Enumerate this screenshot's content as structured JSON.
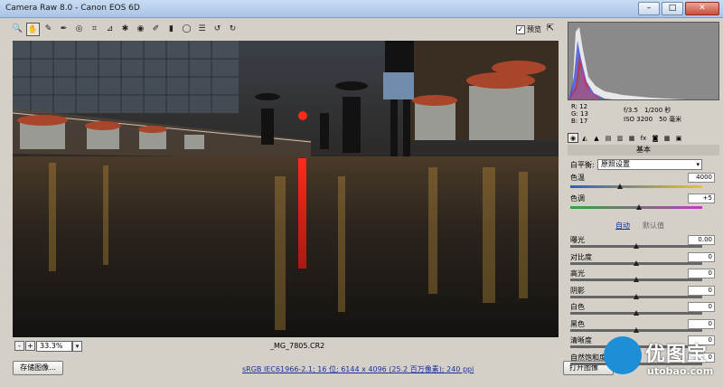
{
  "window": {
    "title": "Camera Raw 8.0 -  Canon EOS 6D",
    "minimize": "–",
    "maximize": "□",
    "close": "✕"
  },
  "toolbar": {
    "tools": [
      {
        "name": "zoom-tool-icon",
        "glyph": "🔍"
      },
      {
        "name": "hand-tool-icon",
        "glyph": "✋"
      },
      {
        "name": "white-balance-tool-icon",
        "glyph": "✎"
      },
      {
        "name": "color-sampler-tool-icon",
        "glyph": "✒"
      },
      {
        "name": "targeted-adjustment-tool-icon",
        "glyph": "◎"
      },
      {
        "name": "crop-tool-icon",
        "glyph": "⌗"
      },
      {
        "name": "straighten-tool-icon",
        "glyph": "⊿"
      },
      {
        "name": "spot-removal-tool-icon",
        "glyph": "✱"
      },
      {
        "name": "red-eye-tool-icon",
        "glyph": "◉"
      },
      {
        "name": "adjustment-brush-icon",
        "glyph": "✐"
      },
      {
        "name": "graduated-filter-icon",
        "glyph": "▮"
      },
      {
        "name": "radial-filter-icon",
        "glyph": "◯"
      },
      {
        "name": "preferences-icon",
        "glyph": "☰"
      },
      {
        "name": "rotate-ccw-icon",
        "glyph": "↺"
      },
      {
        "name": "rotate-cw-icon",
        "glyph": "↻"
      }
    ],
    "preview_label": "预览",
    "preview_checked": "✓",
    "fullscreen_glyph": "⇱"
  },
  "zoom": {
    "minus": "-",
    "plus": "+",
    "value": "33.3%",
    "dropdown": "▾"
  },
  "filename": "_MG_7805.CR2",
  "bottom": {
    "save_label": "存储图像...",
    "workflow_text": "sRGB IEC61966-2.1; 16 位; 6144 x 4096 (25.2 百万像素); 240 ppi",
    "open_label": "打开图像"
  },
  "watermark": {
    "big": "优图宝",
    "small": "utobao.com"
  },
  "readout": {
    "r": "R:  12",
    "g": "G:  13",
    "b": "B:  17",
    "aperture": "f/3.5",
    "shutter": "1/200 秒",
    "iso": "ISO 3200",
    "focal": "50 毫米"
  },
  "panel_tabs": [
    "◉",
    "◭",
    "▲",
    "▤",
    "▥",
    "▦",
    "fx",
    "◙",
    "▩",
    "▣"
  ],
  "basic": {
    "title": "基本",
    "wb_label": "白平衡:",
    "wb_value": "原照设置",
    "wb_dropdown": "▾",
    "temp_label": "色温",
    "temp_value": "4000",
    "temp_level": 0.38,
    "tint_label": "色调",
    "tint_value": "+5",
    "tint_level": 0.52,
    "auto_label": "自动",
    "default_label": "默认值",
    "sliders": [
      {
        "label": "曝光",
        "value": "0.00",
        "level": 0.5
      },
      {
        "label": "对比度",
        "value": "0",
        "level": 0.5
      },
      {
        "label": "高光",
        "value": "0",
        "level": 0.5
      },
      {
        "label": "阴影",
        "value": "0",
        "level": 0.5
      },
      {
        "label": "白色",
        "value": "0",
        "level": 0.5
      },
      {
        "label": "黑色",
        "value": "0",
        "level": 0.5
      },
      {
        "label": "清晰度",
        "value": "0",
        "level": 0.5
      },
      {
        "label": "自然饱和度",
        "value": "0",
        "level": 0.5
      }
    ]
  }
}
